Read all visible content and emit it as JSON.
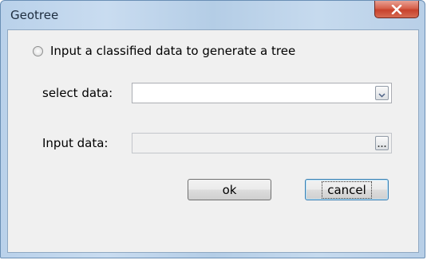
{
  "window": {
    "title": "Geotree",
    "close_icon": "close-x-icon",
    "accent": "#c7422c"
  },
  "option": {
    "label": "Input a classified data to generate a tree",
    "selected": false
  },
  "select_data": {
    "label": "select data:",
    "value": "",
    "icon": "chevron-down-icon"
  },
  "input_data": {
    "label": "Input data:",
    "value": "",
    "icon": "ellipsis-icon"
  },
  "buttons": {
    "ok": "ok",
    "cancel": "cancel"
  }
}
